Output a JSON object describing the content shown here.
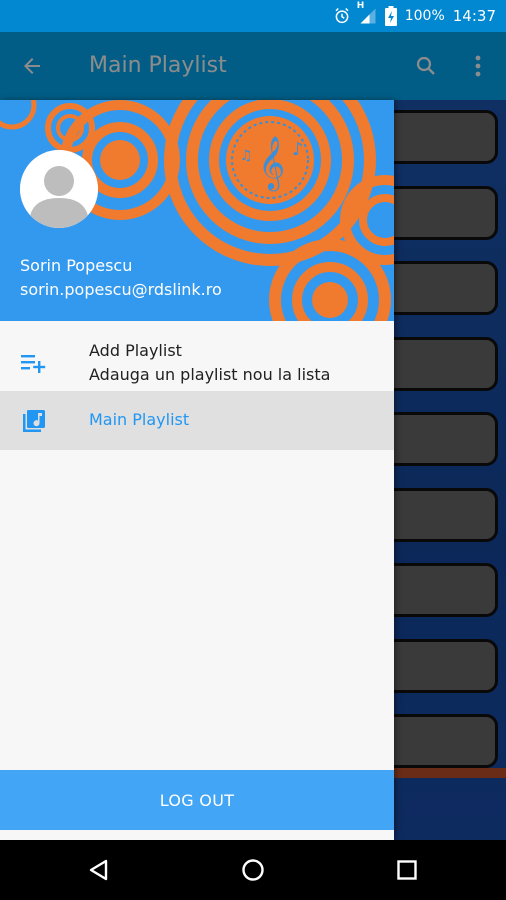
{
  "status_bar": {
    "network_type": "H",
    "battery_percent": "100%",
    "time": "14:37"
  },
  "toolbar": {
    "title": "Main Playlist"
  },
  "drawer": {
    "user": {
      "name": "Sorin Popescu",
      "email": "sorin.popescu@rdslink.ro"
    },
    "menu": {
      "add_playlist": {
        "title": "Add Playlist",
        "subtitle": "Adauga un playlist nou la lista",
        "icon": "playlist-add-icon"
      },
      "main_playlist": {
        "title": "Main Playlist",
        "icon": "library-music-icon",
        "selected": true
      }
    },
    "logout_label": "LOG OUT"
  },
  "content": {
    "track_card_count": 9
  },
  "colors": {
    "primary": "#03a9f4",
    "primary_dark": "#0288d1",
    "header_bg": "#3399ee",
    "accent_orange": "#f07b2f",
    "selected_text": "#2196f3",
    "logout_bg": "#42a5f5"
  }
}
